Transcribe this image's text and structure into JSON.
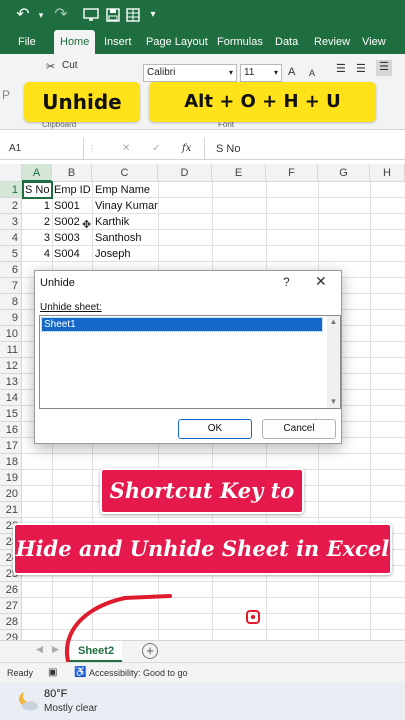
{
  "titlebar": {
    "icons": [
      "undo-icon",
      "redo-icon",
      "present-icon",
      "save-icon",
      "table-icon",
      "customize-icon"
    ]
  },
  "ribbon_tabs": [
    "File",
    "Home",
    "Insert",
    "Page Layout",
    "Formulas",
    "Data",
    "Review",
    "View"
  ],
  "active_tab": "Home",
  "ribbon": {
    "cut_label": "Cut",
    "paste_label": "P",
    "clipboard_label": "Clipboard",
    "font_name": "Calibri",
    "font_size": "11",
    "grow_font": "A",
    "shrink_font": "A",
    "font_group_label": "Font"
  },
  "banners": {
    "unhide": "Unhide",
    "shortcut": "Alt + O + H + U"
  },
  "formula_bar": {
    "name_box": "A1",
    "cancel": "✕",
    "enter": "✓",
    "fx": "fx",
    "content": "S No"
  },
  "grid": {
    "columns": [
      "A",
      "B",
      "C",
      "D",
      "E",
      "F",
      "G",
      "H"
    ],
    "rows": [
      "1",
      "2",
      "3",
      "4",
      "5",
      "6",
      "7",
      "8",
      "9",
      "10",
      "11",
      "12",
      "13",
      "14",
      "15",
      "16",
      "17",
      "18",
      "19",
      "20",
      "21",
      "22",
      "23",
      "24",
      "25",
      "26",
      "27",
      "28",
      "29"
    ],
    "header_row": [
      "S No",
      "Emp ID",
      "Emp Name"
    ],
    "data_rows": [
      [
        "1",
        "S001",
        "Vinay Kumar"
      ],
      [
        "2",
        "S002",
        "Karthik"
      ],
      [
        "3",
        "S003",
        "Santhosh"
      ],
      [
        "4",
        "S004",
        "Joseph"
      ]
    ]
  },
  "dialog": {
    "title": "Unhide",
    "help": "?",
    "close": "✕",
    "label": "Unhide sheet:",
    "items": [
      "Sheet1"
    ],
    "ok": "OK",
    "cancel": "Cancel"
  },
  "captions": {
    "line1": "Shortcut Key to",
    "line2": "Hide and Unhide Sheet in Excel"
  },
  "sheet_tabs": {
    "active": "Sheet2",
    "add": "+"
  },
  "status_bar": {
    "ready": "Ready",
    "accessibility": "Accessibility: Good to go"
  },
  "taskbar": {
    "temperature": "80°F",
    "condition": "Mostly clear"
  },
  "colors": {
    "excel_green": "#1e6e3f",
    "banner_yellow": "#ffe21a",
    "caption_pink": "#e5194c",
    "selection_blue": "#1669c9",
    "annotation_red": "#e01b2e"
  }
}
